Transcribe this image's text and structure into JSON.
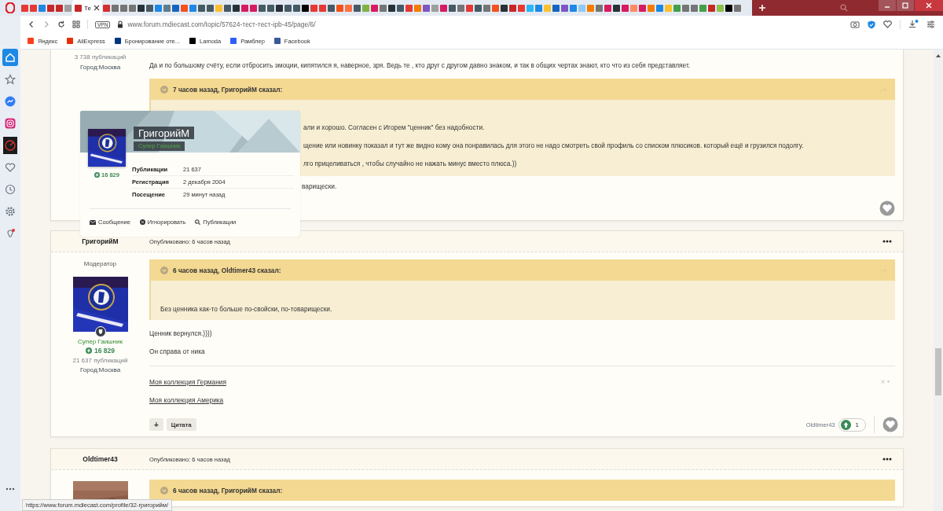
{
  "tabs": [
    {
      "selected": false,
      "color": "#e53935"
    },
    {
      "selected": false,
      "color": "#e53935"
    },
    {
      "selected": false,
      "color": "#1e88e5"
    },
    {
      "selected": false,
      "color": "#c62828"
    },
    {
      "selected": false,
      "color": "#c62828"
    },
    {
      "selected": false,
      "color": "#9e9e9e"
    },
    {
      "selected": true,
      "label": "Те",
      "color": "#c62828"
    },
    {
      "selected": false,
      "color": "#d32f2f"
    },
    {
      "selected": false,
      "color": "#757575"
    },
    {
      "selected": false,
      "color": "#757575"
    },
    {
      "selected": false,
      "color": "#757575"
    },
    {
      "selected": false,
      "color": "#263238"
    },
    {
      "selected": false,
      "color": "#455a64"
    },
    {
      "selected": false,
      "color": "#1e88e5"
    },
    {
      "selected": false,
      "color": "#607d8b"
    },
    {
      "selected": false,
      "color": "#1565c0"
    },
    {
      "selected": false,
      "color": "#f4511e"
    },
    {
      "selected": false,
      "color": "#1e88e5"
    },
    {
      "selected": false,
      "color": "#455a64"
    },
    {
      "selected": false,
      "color": "#455a64"
    },
    {
      "selected": false,
      "color": "#fbc02d"
    },
    {
      "selected": false,
      "color": "#455a64"
    },
    {
      "selected": false,
      "color": "#263238"
    },
    {
      "selected": false,
      "color": "#d81b60"
    },
    {
      "selected": false,
      "color": "#d81b60"
    },
    {
      "selected": false,
      "color": "#455a64"
    },
    {
      "selected": false,
      "color": "#455a64"
    },
    {
      "selected": false,
      "color": "#263238"
    },
    {
      "selected": false,
      "color": "#455a64"
    },
    {
      "selected": false,
      "color": "#455a64"
    },
    {
      "selected": false,
      "color": "#000000"
    },
    {
      "selected": false,
      "color": "#e53935"
    },
    {
      "selected": false,
      "color": "#e53935"
    },
    {
      "selected": false,
      "color": "#455a64"
    },
    {
      "selected": false,
      "color": "#f4511e"
    },
    {
      "selected": false,
      "color": "#ff7043"
    },
    {
      "selected": false,
      "color": "#455a64"
    },
    {
      "selected": false,
      "color": "#7cb342"
    },
    {
      "selected": false,
      "color": "#d81b60"
    },
    {
      "selected": false,
      "color": "#757575"
    },
    {
      "selected": false,
      "color": "#263238"
    },
    {
      "selected": false,
      "color": "#455a64"
    },
    {
      "selected": false,
      "color": "#e53935"
    },
    {
      "selected": false,
      "color": "#f57c00"
    },
    {
      "selected": false,
      "color": "#7e57c2"
    },
    {
      "selected": false,
      "color": "#9e9e9e"
    },
    {
      "selected": false,
      "color": "#d81b60"
    },
    {
      "selected": false,
      "color": "#455a64"
    },
    {
      "selected": false,
      "color": "#757575"
    },
    {
      "selected": false,
      "color": "#e53935"
    },
    {
      "selected": false,
      "color": "#455a64"
    },
    {
      "selected": false,
      "color": "#757575"
    },
    {
      "selected": false,
      "color": "#f4511e"
    },
    {
      "selected": false,
      "color": "#263238"
    },
    {
      "selected": false,
      "color": "#c62828"
    },
    {
      "selected": false,
      "color": "#e53935"
    },
    {
      "selected": false,
      "color": "#29b6f6"
    },
    {
      "selected": false,
      "color": "#1e88e5"
    },
    {
      "selected": false,
      "color": "#fbc02d"
    },
    {
      "selected": false,
      "color": "#1565c0"
    },
    {
      "selected": false,
      "color": "#7e57c2"
    },
    {
      "selected": false,
      "color": "#1e88e5"
    },
    {
      "selected": false,
      "color": "#90caf9"
    },
    {
      "selected": false,
      "color": "#f57c00"
    },
    {
      "selected": false,
      "color": "#757575"
    },
    {
      "selected": false,
      "color": "#d81b60"
    },
    {
      "selected": false,
      "color": "#263238"
    },
    {
      "selected": false,
      "color": "#d81b60"
    },
    {
      "selected": false,
      "color": "#ff8a65"
    },
    {
      "selected": false,
      "color": "#d81b60"
    },
    {
      "selected": false,
      "color": "#f57c00"
    },
    {
      "selected": false,
      "color": "#1e88e5"
    },
    {
      "selected": false,
      "color": "#fbc02d"
    },
    {
      "selected": false,
      "color": "#43a047"
    },
    {
      "selected": false,
      "color": "#757575"
    },
    {
      "selected": false,
      "color": "#757575"
    },
    {
      "selected": false,
      "color": "#43a047"
    },
    {
      "selected": false,
      "color": "#c62828"
    },
    {
      "selected": false,
      "color": "#8bc34a"
    },
    {
      "selected": false,
      "color": "#000000"
    },
    {
      "selected": false,
      "color": "#757575"
    }
  ],
  "address_bar": {
    "vpn": "VPN",
    "url": "www.forum.mdiecast.com/topic/57624-тест-тест-ipb-45/page/6/"
  },
  "bookmarks": [
    {
      "label": "Яндекс",
      "color": "#fc3f1d"
    },
    {
      "label": "AliExpress",
      "color": "#e62e04"
    },
    {
      "label": "Бронирование оте...",
      "color": "#003580"
    },
    {
      "label": "Lamoda",
      "color": "#000000"
    },
    {
      "label": "Рамблер",
      "color": "#315efb"
    },
    {
      "label": "Facebook",
      "color": "#3b5998"
    }
  ],
  "sidebar": {
    "items": [
      {
        "kind": "home",
        "selected": true
      },
      {
        "kind": "star",
        "selected": false
      },
      {
        "kind": "messenger",
        "selected": false
      },
      {
        "kind": "instagram",
        "selected": false
      },
      {
        "kind": "speed",
        "selected": false
      },
      {
        "kind": "heart",
        "selected": false
      },
      {
        "kind": "history",
        "selected": false
      },
      {
        "kind": "settings",
        "selected": false
      },
      {
        "kind": "tips",
        "selected": false
      }
    ]
  },
  "posts": [
    {
      "posts_count": "3 738 публикаций",
      "city": "Город:Москва",
      "paragraphs": [
        "Да и по большому счёту, если отбросить эмоции, кипятился я, наверное, зря. Ведь те , кто друг с другом давно знаком, и так в общих чертах знают, кто что из себя представляет."
      ],
      "quote": {
        "header": "7 часов назад, ГригорийМ сказал:",
        "lines": [
          {
            "kind": "fragment",
            "text": "али и хорошо. Согласен с Игорем \"ценник\" без надобности."
          },
          {
            "kind": "fragment",
            "text": "щение или новинку показал и тут же видно кому она понравилась для этого не надо смотреть свой профиль со списком плюсиков.  который ещё и грузился подолгу."
          },
          {
            "kind": "fragment",
            "text": "лго прицеливаться , чтобы случайно не нажать минус вместо плюса.))"
          }
        ]
      },
      "after_quote": "варищески."
    },
    {
      "author": "ГригорийМ",
      "date": "Опубликовано: 6 часов назад",
      "group": "Модератор",
      "title": "Супер Гаишник",
      "reputation": "16 829",
      "posts_count": "21 637 публикаций",
      "city": "Город:Москва",
      "quote": {
        "header": "6 часов назад, Oldtimer43 сказал:",
        "lines": [
          {
            "kind": "full",
            "text": "Без ценника как-то больше по-свойски, по-товарищески."
          }
        ]
      },
      "paragraphs": [
        "Ценник вернулся.))))",
        "Он справа от ника"
      ],
      "signature": [
        "Моя коллекция Германия",
        "Моя коллекция Америка"
      ],
      "buttons": [
        "+",
        "Цитата"
      ],
      "reaction": {
        "user": "Oldtimer43",
        "count": "1"
      }
    },
    {
      "author": "Oldtimer43",
      "date": "Опубликовано: 6 часов назад",
      "quote": {
        "header": "6 часов назад, ГригорийМ сказал:"
      }
    }
  ],
  "profile_card": {
    "name": "ГригорийМ",
    "title": "Супер Гаишник",
    "reputation": "16 829",
    "stats": [
      {
        "label": "Публикации",
        "value": "21 637"
      },
      {
        "label": "Регистрация",
        "value": "2 декабря 2004"
      },
      {
        "label": "Посещение",
        "value": "29 минут назад"
      }
    ],
    "actions": [
      {
        "kind": "message",
        "label": "Сообщение"
      },
      {
        "kind": "ignore",
        "label": "Игнорировать"
      },
      {
        "kind": "search",
        "label": "Публикации"
      }
    ]
  },
  "status_bar": "https://www.forum.mdiecast.com/profile/32-григорийм/"
}
